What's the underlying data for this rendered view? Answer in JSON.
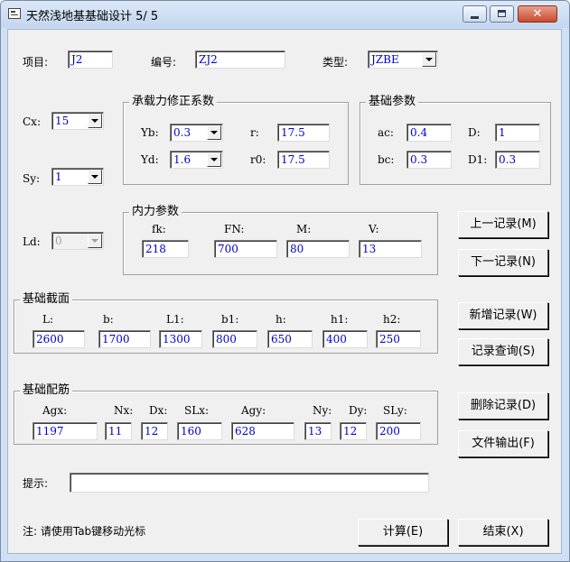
{
  "window": {
    "title": "天然浅地基基础设计 5/ 5",
    "close_glyph": "✕"
  },
  "header": {
    "project_label": "项目:",
    "project_value": "J2",
    "number_label": "编号:",
    "number_value": "ZJ2",
    "type_label": "类型:",
    "type_value": "JZBE"
  },
  "left": {
    "cx_label": "Cx:",
    "cx_value": "15",
    "sy_label": "Sy:",
    "sy_value": "1",
    "ld_label": "Ld:",
    "ld_value": "0"
  },
  "bearing": {
    "title": "承载力修正系数",
    "yb_label": "Yb:",
    "yb_value": "0.3",
    "yd_label": "Yd:",
    "yd_value": "1.6",
    "r_label": "r:",
    "r_value": "17.5",
    "r0_label": "r0:",
    "r0_value": "17.5"
  },
  "base_params": {
    "title": "基础参数",
    "ac_label": "ac:",
    "ac_value": "0.4",
    "bc_label": "bc:",
    "bc_value": "0.3",
    "d_label": "D:",
    "d_value": "1",
    "d1_label": "D1:",
    "d1_value": "0.3"
  },
  "forces": {
    "title": "内力参数",
    "fk_label": "fk:",
    "fk_value": "218",
    "fn_label": "FN:",
    "fn_value": "700",
    "m_label": "M:",
    "m_value": "80",
    "v_label": "V:",
    "v_value": "13"
  },
  "section": {
    "title": "基础截面",
    "l_label": "L:",
    "l_value": "2600",
    "b_label": "b:",
    "b_value": "1700",
    "l1_label": "L1:",
    "l1_value": "1300",
    "b1_label": "b1:",
    "b1_value": "800",
    "h_label": "h:",
    "h_value": "650",
    "h1_label": "h1:",
    "h1_value": "400",
    "h2_label": "h2:",
    "h2_value": "250"
  },
  "rebar": {
    "title": "基础配筋",
    "agx_label": "Agx:",
    "agx_value": "1197",
    "nx_label": "Nx:",
    "nx_value": "11",
    "dx_label": "Dx:",
    "dx_value": "12",
    "slx_label": "SLx:",
    "slx_value": "160",
    "agy_label": "Agy:",
    "agy_value": "628",
    "ny_label": "Ny:",
    "ny_value": "13",
    "dy_label": "Dy:",
    "dy_value": "12",
    "sly_label": "SLy:",
    "sly_value": "200"
  },
  "buttons": {
    "prev": "上一记录(M)",
    "next": "下一记录(N)",
    "add": "新增记录(W)",
    "query": "记录查询(S)",
    "delete": "删除记录(D)",
    "export": "文件输出(F)",
    "calc": "计算(E)",
    "finish": "结束(X)"
  },
  "footer": {
    "hint_label": "提示:",
    "hint_value": "",
    "note": "注: 请使用Tab键移动光标"
  }
}
